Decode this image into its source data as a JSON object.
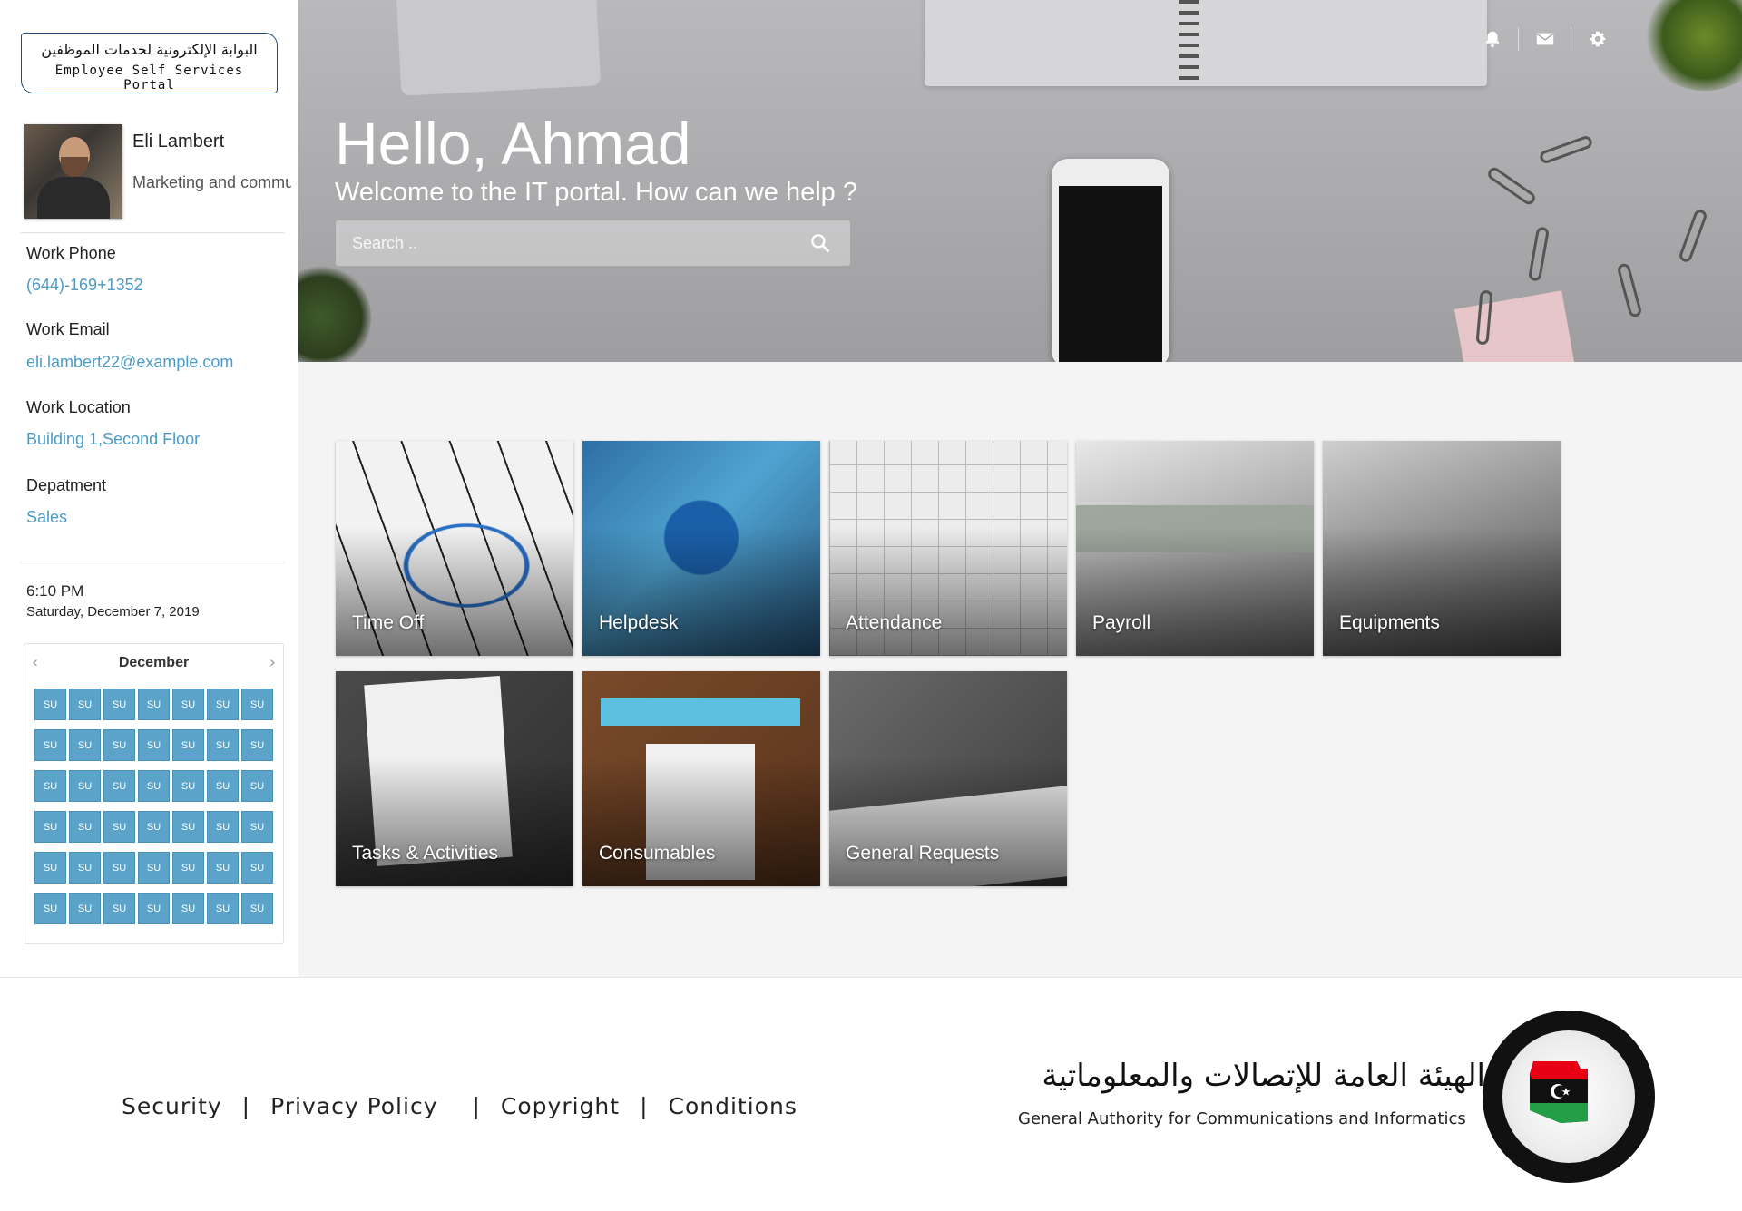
{
  "portal": {
    "logo_ar": "البوابة الإلكترونية لخدمات الموظفين",
    "logo_en": "Employee Self Services Portal"
  },
  "profile": {
    "name": "Eli Lambert",
    "role": "Marketing and community Manage"
  },
  "info": {
    "phone_label": "Work Phone",
    "phone_value": "(644)-169+1352",
    "email_label": "Work Email",
    "email_value": "eli.lambert22@example.com",
    "location_label": "Work Location",
    "location_value": "Building 1,Second Floor",
    "department_label": "Depatment",
    "department_value": "Sales"
  },
  "clock": {
    "time": "6:10 PM",
    "date": "Saturday, December 7, 2019"
  },
  "calendar": {
    "month": "December",
    "prev_icon": "chevron-left-icon",
    "next_icon": "chevron-right-icon",
    "cells": [
      "SU",
      "SU",
      "SU",
      "SU",
      "SU",
      "SU",
      "SU",
      "SU",
      "SU",
      "SU",
      "SU",
      "SU",
      "SU",
      "SU",
      "SU",
      "SU",
      "SU",
      "SU",
      "SU",
      "SU",
      "SU",
      "SU",
      "SU",
      "SU",
      "SU",
      "SU",
      "SU",
      "SU",
      "SU",
      "SU",
      "SU",
      "SU",
      "SU",
      "SU",
      "SU",
      "SU",
      "SU",
      "SU",
      "SU",
      "SU",
      "SU",
      "SU"
    ]
  },
  "hero": {
    "title": "Hello, Ahmad",
    "subtitle": "Welcome to the IT portal. How can we help ?",
    "search_placeholder": "Search ..",
    "icons": [
      "bell-icon",
      "mail-icon",
      "gear-icon"
    ]
  },
  "tiles": [
    {
      "label": "Time Off"
    },
    {
      "label": "Helpdesk"
    },
    {
      "label": "Attendance"
    },
    {
      "label": "Payroll"
    },
    {
      "label": "Equipments"
    },
    {
      "label": "Tasks & Activities"
    },
    {
      "label": "Consumables"
    },
    {
      "label": "General Requests"
    }
  ],
  "footer": {
    "links": [
      "Security",
      "Privacy Policy",
      "Copyright",
      "Conditions"
    ],
    "org_ar": "الهيئة العامة للإتصالات والمعلوماتية",
    "org_en": "General Authority for Communications and Informatics"
  },
  "colors": {
    "accent": "#4a9bc8",
    "calendar_cell": "#5ba3c9",
    "content_bg": "#f4f4f4"
  }
}
